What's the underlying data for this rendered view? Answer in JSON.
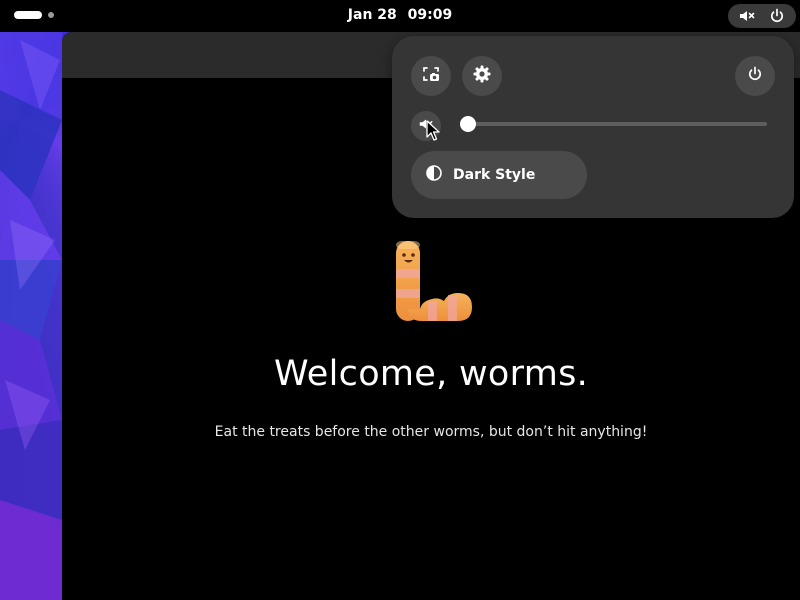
{
  "topbar": {
    "date": "Jan 28",
    "time": "09:09",
    "status_icons": [
      "audio-muted-icon",
      "power-icon"
    ]
  },
  "app": {
    "welcome_title": "Welcome, worms.",
    "welcome_subtitle": "Eat the treats before the other worms, but don’t hit anything!",
    "icon": "worm-icon"
  },
  "quick_settings": {
    "buttons": [
      "screenshot-icon",
      "settings-icon",
      "power-icon"
    ],
    "volume": {
      "icon": "audio-muted-icon",
      "level": 0.0
    },
    "dark_style": {
      "label": "Dark Style",
      "icon": "dark-mode-icon",
      "active": false
    }
  },
  "colors": {
    "topbar": "#000000",
    "menu_bg": "#353535",
    "button_bg": "#4a4a4a",
    "worm_orange": "#f3a04a",
    "worm_pink": "#e89aa8"
  }
}
